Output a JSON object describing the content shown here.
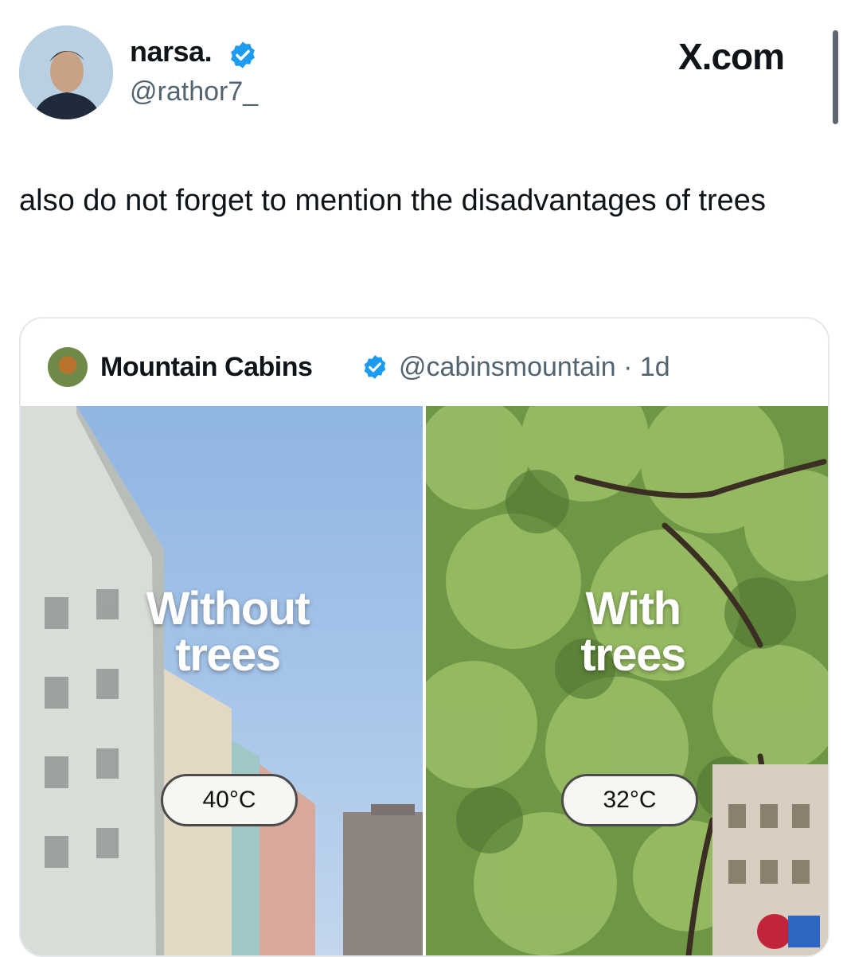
{
  "tweet": {
    "author_name": "narsa.",
    "author_handle": "@rathor7_",
    "site": "X.com",
    "text": "also do not forget to mention the disadvantages of trees"
  },
  "quoted_tweet": {
    "author_name": "Mountain Cabins",
    "author_handle": "@cabinsmountain · 1d",
    "media": {
      "left_label_line1": "Without",
      "left_label_line2": "trees",
      "left_temp": "40°C",
      "right_label_line1": "With",
      "right_label_line2": "trees",
      "right_temp": "32°C"
    }
  },
  "colors": {
    "verified_badge": "#1d9bf0",
    "handle_gray": "#536471",
    "sky_blue": "#8fb5e1",
    "tree_green": "#7aa050"
  },
  "icons": {
    "verified": "verified-badge-icon",
    "avatar": "profile-photo",
    "quoted_avatar": "cabin-photo"
  }
}
